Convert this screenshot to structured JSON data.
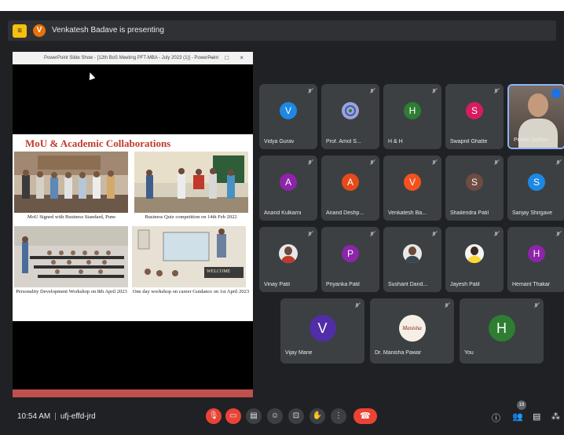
{
  "presenting": {
    "text": "Venkatesh Badave is presenting",
    "avatar_letter": "V"
  },
  "ppt": {
    "window_title": "PowerPoint Slide Show - [12th BoS Meeting PFT-MBA - July 2023 (1)] - PowerPoint",
    "window_controls": "– □ ×"
  },
  "slide": {
    "title": "MoU  &  Academic Collaborations",
    "captions": [
      "MoU Signed with Business Standard, Pune",
      "Business Quiz competition on 14th Feb 2022",
      "Personality Development Workshop on 8th April 2023",
      "One day workshop on career Guidance on 1st April 2023"
    ],
    "welcome_sign": "WELCOME"
  },
  "participants": [
    {
      "name": "Vidya Gurav",
      "letter": "V",
      "color": "#1e88e5"
    },
    {
      "name": "Prof. Amol S...",
      "letter": "",
      "color": "#8e8ec8"
    },
    {
      "name": "H & H",
      "letter": "H",
      "color": "#2e7d32"
    },
    {
      "name": "Swapnil Ghatte",
      "letter": "S",
      "color": "#d81b60"
    },
    {
      "name": "Pravin Jadhav",
      "letter": "",
      "color": "#5a4e47"
    },
    {
      "name": "Anand Kulkarni",
      "letter": "A",
      "color": "#8e24aa"
    },
    {
      "name": "Anand Deshp...",
      "letter": "A",
      "color": "#e64a19"
    },
    {
      "name": "Venkatesh Ba...",
      "letter": "V",
      "color": "#f4511e"
    },
    {
      "name": "Shailendra Patil",
      "letter": "S",
      "color": "#6d4c41"
    },
    {
      "name": "Sanjay Shirgave",
      "letter": "S",
      "color": "#1e88e5"
    },
    {
      "name": "Vinay Patil",
      "letter": "",
      "color": "#e8e8e8"
    },
    {
      "name": "Priyanka Patil",
      "letter": "P",
      "color": "#8e24aa"
    },
    {
      "name": "Sushant Dand...",
      "letter": "",
      "color": "#e8e8e8"
    },
    {
      "name": "Jayesh Patil",
      "letter": "",
      "color": "#e8e8e8"
    },
    {
      "name": "Hemant Thakar",
      "letter": "H",
      "color": "#8e24aa"
    },
    {
      "name": "Vijay Mane",
      "letter": "V",
      "color": "#512da8"
    },
    {
      "name": "Dr. Manisha Pawar",
      "letter": "Manisha",
      "color": "#f5efe6"
    },
    {
      "name": "You",
      "letter": "H",
      "color": "#2e7d32"
    }
  ],
  "bottom": {
    "time": "10:54 AM",
    "separator": "|",
    "meeting_code": "ufj-effd-jrd",
    "participant_badge": "19"
  },
  "colors": {
    "background": "#202124",
    "tile": "#3c4043",
    "end_call": "#ea4335",
    "active_speaker": "#8ab4f8"
  }
}
